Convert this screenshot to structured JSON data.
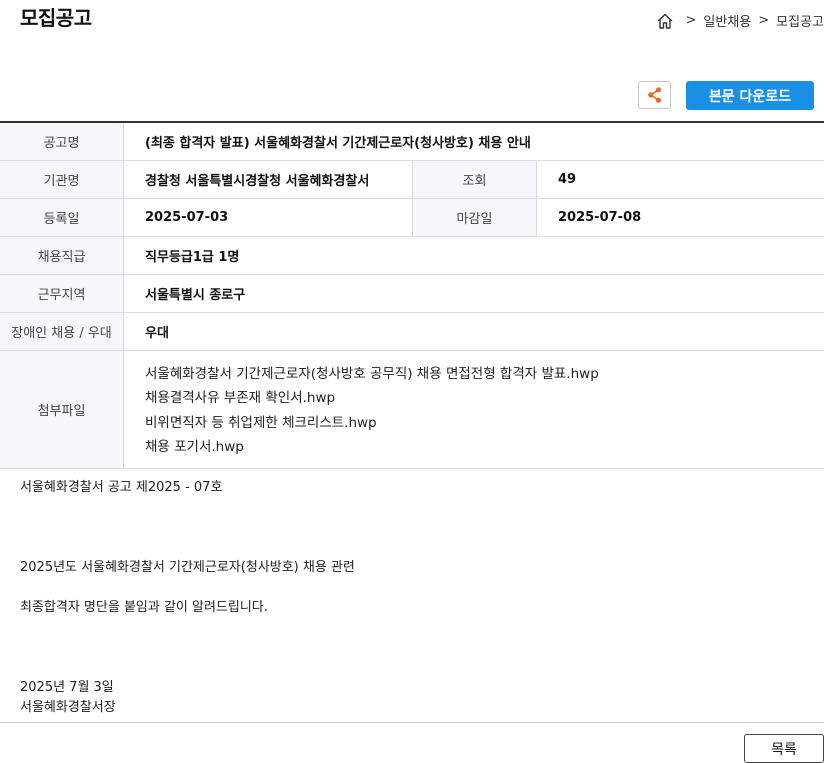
{
  "page": {
    "title": "모집공고"
  },
  "breadcrumb": {
    "home_icon": "home-icon",
    "sep": ">",
    "items": [
      "일반채용",
      "모집공고"
    ]
  },
  "toolbar": {
    "share_icon": "share-icon",
    "download_label": "본문 다운로드"
  },
  "info": {
    "title_label": "공고명",
    "title_value": "(최종 합격자 발표) 서울혜화경찰서 기간제근로자(청사방호) 채용 안내",
    "org_label": "기관명",
    "org_value": "경찰청 서울특별시경찰청 서울혜화경찰서",
    "views_label": "조회",
    "views_value": "49",
    "reg_label": "등록일",
    "reg_value": "2025-07-03",
    "deadline_label": "마감일",
    "deadline_value": "2025-07-08",
    "grade_label": "채용직급",
    "grade_value": "직무등급1급 1명",
    "region_label": "근무지역",
    "region_value": "서울특별시 종로구",
    "disabled_label": "장애인 채용 / 우대",
    "disabled_value": "우대",
    "attach_label": "첨부파일",
    "attachments": [
      "서울혜화경찰서 기간제근로자(청사방호 공무직) 채용 면접전형 합격자 발표.hwp",
      "채용결격사유 부존재 확인서.hwp",
      "비위면직자 등 취업제한 체크리스트.hwp",
      "채용 포기서.hwp"
    ]
  },
  "body": {
    "notice_no": "서울혜화경찰서 공고 제2025 - 07호",
    "line1": "2025년도 서울혜화경찰서 기간제근로자(청사방호) 채용 관련",
    "line2": "최종합격자 명단을 붙임과 같이 알려드립니다.",
    "date": "2025년  7월  3일",
    "signer": "서울혜화경찰서장"
  },
  "footer": {
    "list_label": "목록"
  }
}
